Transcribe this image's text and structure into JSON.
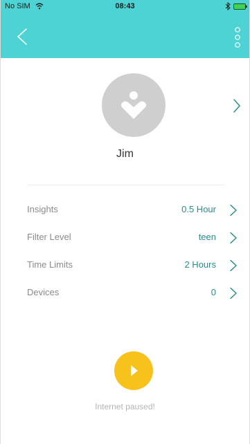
{
  "status_bar": {
    "carrier": "No SIM",
    "time": "08:43",
    "wifi_icon": "wifi-icon",
    "bluetooth_icon": "bluetooth-icon",
    "battery_icon": "battery-icon"
  },
  "nav": {
    "back_icon": "chevron-left-icon",
    "more_icon": "more-vertical-icon"
  },
  "profile": {
    "name": "Jim",
    "avatar_icon": "user-heart-icon",
    "chevron_icon": "chevron-right-icon"
  },
  "rows": [
    {
      "label": "Insights",
      "value": "0.5 Hour"
    },
    {
      "label": "Filter Level",
      "value": "teen"
    },
    {
      "label": "Time Limits",
      "value": "2 Hours"
    },
    {
      "label": "Devices",
      "value": "0"
    }
  ],
  "internet": {
    "play_icon": "play-icon",
    "status_text": "Internet paused!"
  },
  "colors": {
    "header": "#4dd3d3",
    "value_text": "#2a8c8c",
    "label_text": "#8a8a8a",
    "avatar_bg": "#cfcfcf",
    "play_button": "#f7c21b",
    "paused_text": "#b5b5b5"
  }
}
